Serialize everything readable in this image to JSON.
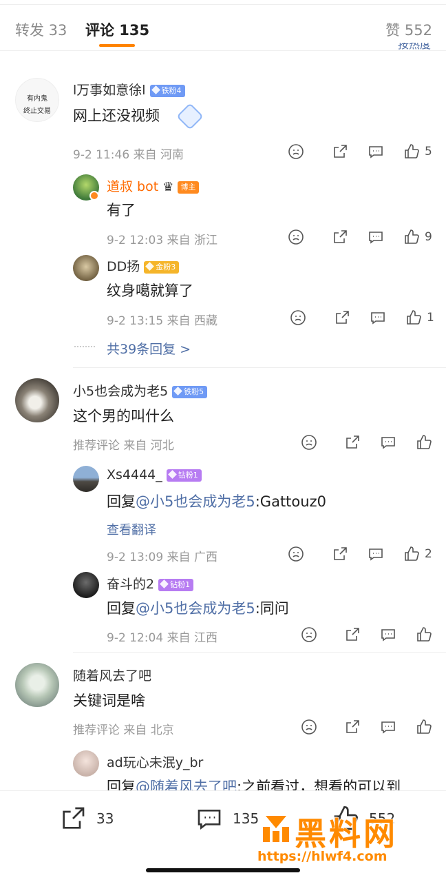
{
  "tabs": {
    "repost": "转发 33",
    "comments": "评论 135",
    "likes": "赞 552",
    "sort": "按热度"
  },
  "comments": [
    {
      "avatar_text_1": "有内鬼",
      "avatar_text_2": "终止交易",
      "name": "l万事如意徐l",
      "badge": "铁粉4",
      "text": "网上还没视频",
      "meta": "9-2 11:46  来自 河南",
      "likes": "5",
      "replies": [
        {
          "name": "道叔 bot",
          "badge": "博主",
          "text": "有了",
          "meta": "9-2 12:03  来自 浙江",
          "likes": "9"
        },
        {
          "name": "DD扬",
          "badge": "金粉3",
          "text": "纹身噶就算了",
          "meta": "9-2 13:15  来自 西藏",
          "likes": "1"
        }
      ],
      "more": "共39条回复 >"
    },
    {
      "name": "小5也会成为老5",
      "badge": "铁粉5",
      "text": "这个男的叫什么",
      "meta": "推荐评论  来自 河北",
      "replies": [
        {
          "name": "Xs4444_",
          "badge": "钻粉1",
          "prefix": "回复",
          "mention": "@小5也会成为老5",
          "rest": ":Gattouz0",
          "translate": "查看翻译",
          "meta": "9-2 13:09  来自 广西",
          "likes": "2"
        },
        {
          "name": "奋斗的2",
          "badge": "钻粉1",
          "prefix": "回复",
          "mention": "@小5也会成为老5",
          "rest": ":同问",
          "meta": "9-2 12:04  来自 江西"
        }
      ]
    },
    {
      "name": "随着风去了吧",
      "text": "关键词是啥",
      "meta": "推荐评论  来自 北京",
      "replies": [
        {
          "name": "ad玩心未泯y_br",
          "prefix": "回复",
          "mention": "@随着风去了吧",
          "rest": ":之前看过，想看的可以到"
        }
      ]
    }
  ],
  "bottom": {
    "repost": "33",
    "comment": "135",
    "like": "552"
  },
  "watermark": {
    "brand": "黑料网",
    "url": "https://hlwf4.com"
  },
  "colors": {
    "accent": "#ff8200",
    "link": "#506fa6"
  }
}
